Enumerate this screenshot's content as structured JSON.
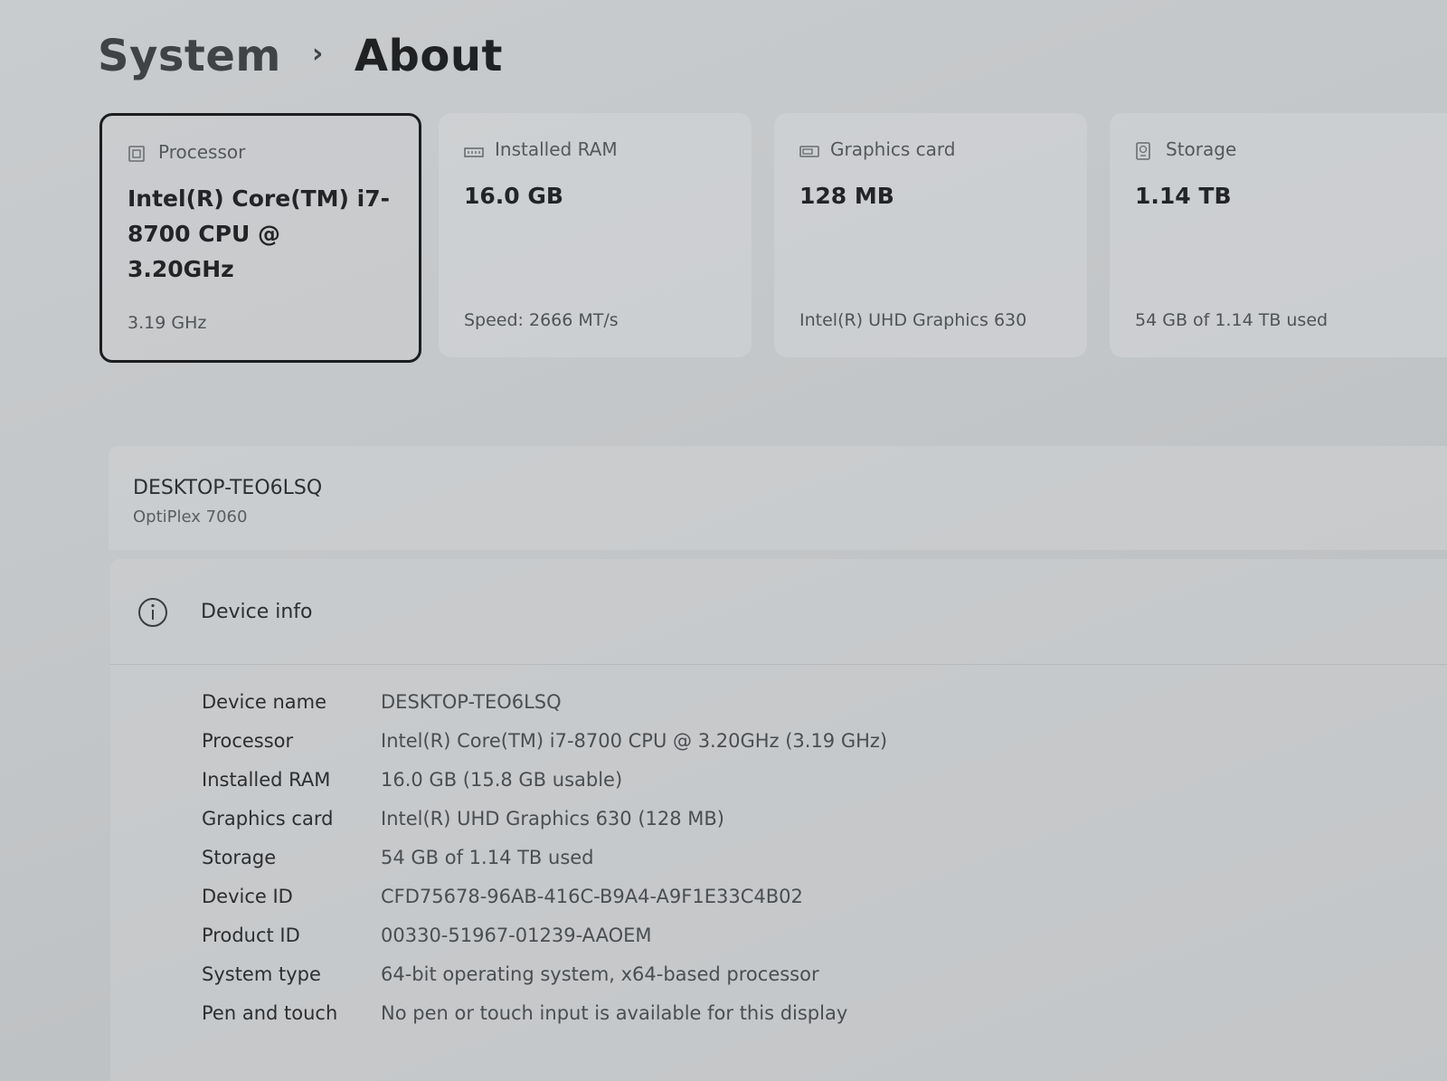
{
  "breadcrumb": {
    "parent": "System",
    "separator": "›",
    "current": "About"
  },
  "cards": [
    {
      "icon": "processor-icon",
      "label": "Processor",
      "value": "Intel(R) Core(TM) i7-8700 CPU @ 3.20GHz",
      "sub": "3.19 GHz",
      "selected": true
    },
    {
      "icon": "ram-icon",
      "label": "Installed RAM",
      "value": "16.0 GB",
      "sub": "Speed: 2666 MT/s",
      "selected": false
    },
    {
      "icon": "graphics-card-icon",
      "label": "Graphics card",
      "value": "128 MB",
      "sub": "Intel(R) UHD Graphics 630",
      "selected": false
    },
    {
      "icon": "storage-icon",
      "label": "Storage",
      "value": "1.14 TB",
      "sub": "54 GB of 1.14 TB used",
      "selected": false
    }
  ],
  "device": {
    "name": "DESKTOP-TEO6LSQ",
    "model": "OptiPlex 7060"
  },
  "device_info": {
    "title": "Device info",
    "rows": [
      {
        "label": "Device name",
        "value": "DESKTOP-TEO6LSQ"
      },
      {
        "label": "Processor",
        "value": "Intel(R) Core(TM) i7-8700 CPU @ 3.20GHz (3.19 GHz)"
      },
      {
        "label": "Installed RAM",
        "value": "16.0 GB (15.8 GB usable)"
      },
      {
        "label": "Graphics card",
        "value": "Intel(R) UHD Graphics 630 (128 MB)"
      },
      {
        "label": "Storage",
        "value": "54 GB of 1.14 TB used"
      },
      {
        "label": "Device ID",
        "value": "CFD75678-96AB-416C-B9A4-A9F1E33C4B02"
      },
      {
        "label": "Product ID",
        "value": "00330-51967-01239-AAOEM"
      },
      {
        "label": "System type",
        "value": "64-bit operating system, x64-based processor"
      },
      {
        "label": "Pen and touch",
        "value": "No pen or touch input is available for this display"
      }
    ]
  }
}
